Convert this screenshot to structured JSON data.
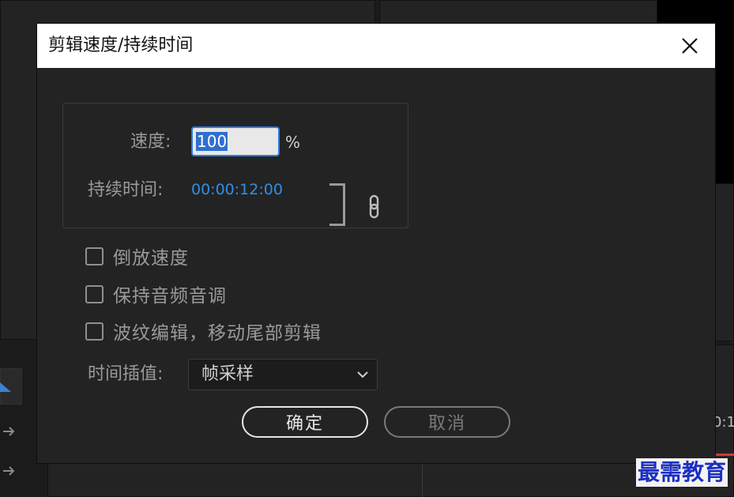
{
  "dialog": {
    "title": "剪辑速度/持续时间",
    "speed_label": "速度:",
    "speed_value": "100",
    "speed_unit": "%",
    "duration_label": "持续时间:",
    "duration_value": "00:00:12:00",
    "checkboxes": [
      {
        "label": "倒放速度",
        "checked": false
      },
      {
        "label": "保持音频音调",
        "checked": false
      },
      {
        "label": "波纹编辑，移动尾部剪辑",
        "checked": false
      }
    ],
    "interpolation_label": "时间插值:",
    "interpolation_value": "帧采样",
    "ok_label": "确定",
    "cancel_label": "取消"
  },
  "background": {
    "timecode_fragment": "0:1"
  },
  "watermark": "最需教育",
  "icons": {
    "close": "close-icon",
    "link": "link-icon",
    "dropdown": "chevron-down-icon"
  },
  "colors": {
    "dialog_bg": "#232323",
    "title_bar": "#ffffff",
    "accent_blue": "#2f8fe6",
    "watermark": "#1b2fc2"
  }
}
